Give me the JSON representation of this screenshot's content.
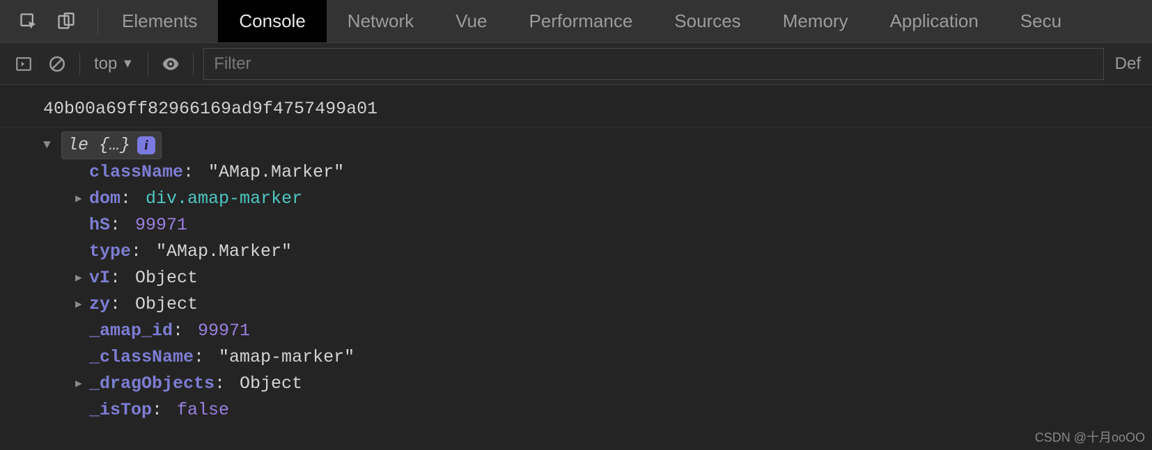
{
  "tabs": [
    "Elements",
    "Console",
    "Network",
    "Vue",
    "Performance",
    "Sources",
    "Memory",
    "Application",
    "Secu"
  ],
  "selectedTab": "Console",
  "toolbar": {
    "context": "top",
    "filter_placeholder": "Filter",
    "levels_label": "Def"
  },
  "log": {
    "line1": "40b00a69ff82966169ad9f4757499a01",
    "objHeader": "le {…}",
    "infoBadge": "i",
    "props": {
      "className": {
        "key": "className",
        "value": "\"AMap.Marker\"",
        "type": "string",
        "expandable": false
      },
      "dom": {
        "key": "dom",
        "tag": "div",
        "cls": ".amap-marker",
        "type": "dom",
        "expandable": true
      },
      "hS": {
        "key": "hS",
        "value": "99971",
        "type": "number",
        "expandable": false
      },
      "type": {
        "key": "type",
        "value": "\"AMap.Marker\"",
        "type": "string",
        "expandable": false
      },
      "vI": {
        "key": "vI",
        "value": "Object",
        "type": "objref",
        "expandable": true
      },
      "zy": {
        "key": "zy",
        "value": "Object",
        "type": "objref",
        "expandable": true
      },
      "_amap_id": {
        "key": "_amap_id",
        "value": "99971",
        "type": "number",
        "expandable": false
      },
      "_className": {
        "key": "_className",
        "value": "\"amap-marker\"",
        "type": "string",
        "expandable": false
      },
      "_dragObjects": {
        "key": "_dragObjects",
        "value": "Object",
        "type": "objref",
        "expandable": true
      },
      "_isTop": {
        "key": "_isTop",
        "value": "false",
        "type": "bool",
        "expandable": false
      }
    }
  },
  "watermark": "CSDN @十月ooOO"
}
